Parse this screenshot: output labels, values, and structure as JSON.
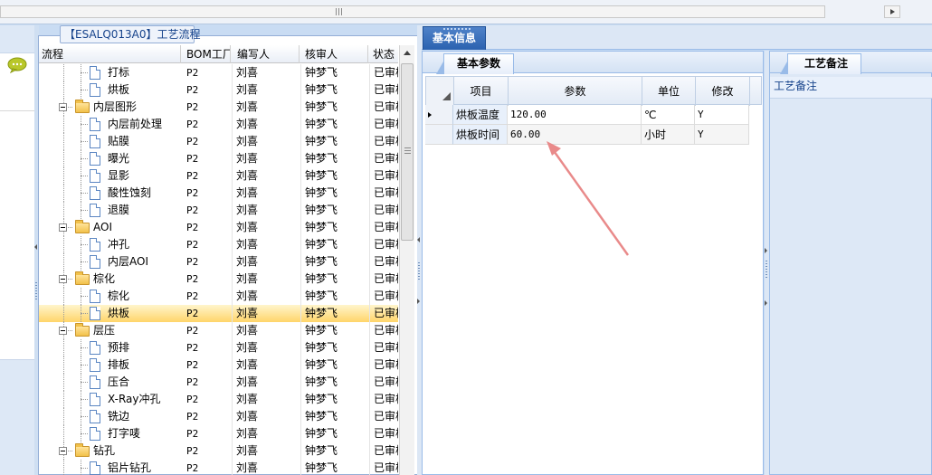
{
  "colors": {
    "accent": "#2b62b0",
    "selection": "#ffd56a",
    "annotation_arrow": "#e98a8a"
  },
  "group": {
    "title": "【ESALQ013A0】工艺流程"
  },
  "tree": {
    "headers": {
      "name": "流程",
      "bom_plant": "BOM工厂",
      "author": "编写人",
      "reviewer": "核审人",
      "status": "状态"
    },
    "rows": [
      {
        "name": "打标",
        "type": "doc",
        "level": 1,
        "bom": "P2",
        "author": "刘喜",
        "reviewer": "钟梦飞",
        "status": "已审核",
        "selected": false
      },
      {
        "name": "烘板",
        "type": "doc",
        "level": 1,
        "bom": "P2",
        "author": "刘喜",
        "reviewer": "钟梦飞",
        "status": "已审核",
        "selected": false
      },
      {
        "name": "内层图形",
        "type": "folder",
        "level": 0,
        "bom": "P2",
        "author": "刘喜",
        "reviewer": "钟梦飞",
        "status": "已审核",
        "selected": false
      },
      {
        "name": "内层前处理",
        "type": "doc",
        "level": 1,
        "bom": "P2",
        "author": "刘喜",
        "reviewer": "钟梦飞",
        "status": "已审核",
        "selected": false
      },
      {
        "name": "贴膜",
        "type": "doc",
        "level": 1,
        "bom": "P2",
        "author": "刘喜",
        "reviewer": "钟梦飞",
        "status": "已审核",
        "selected": false
      },
      {
        "name": "曝光",
        "type": "doc",
        "level": 1,
        "bom": "P2",
        "author": "刘喜",
        "reviewer": "钟梦飞",
        "status": "已审核",
        "selected": false
      },
      {
        "name": "显影",
        "type": "doc",
        "level": 1,
        "bom": "P2",
        "author": "刘喜",
        "reviewer": "钟梦飞",
        "status": "已审核",
        "selected": false
      },
      {
        "name": "酸性蚀刻",
        "type": "doc",
        "level": 1,
        "bom": "P2",
        "author": "刘喜",
        "reviewer": "钟梦飞",
        "status": "已审核",
        "selected": false
      },
      {
        "name": "退膜",
        "type": "doc",
        "level": 1,
        "bom": "P2",
        "author": "刘喜",
        "reviewer": "钟梦飞",
        "status": "已审核",
        "selected": false
      },
      {
        "name": "AOI",
        "type": "folder",
        "level": 0,
        "bom": "P2",
        "author": "刘喜",
        "reviewer": "钟梦飞",
        "status": "已审核",
        "selected": false
      },
      {
        "name": "冲孔",
        "type": "doc",
        "level": 1,
        "bom": "P2",
        "author": "刘喜",
        "reviewer": "钟梦飞",
        "status": "已审核",
        "selected": false
      },
      {
        "name": "内层AOI",
        "type": "doc",
        "level": 1,
        "bom": "P2",
        "author": "刘喜",
        "reviewer": "钟梦飞",
        "status": "已审核",
        "selected": false
      },
      {
        "name": "棕化",
        "type": "folder",
        "level": 0,
        "bom": "P2",
        "author": "刘喜",
        "reviewer": "钟梦飞",
        "status": "已审核",
        "selected": false
      },
      {
        "name": "棕化",
        "type": "doc",
        "level": 1,
        "bom": "P2",
        "author": "刘喜",
        "reviewer": "钟梦飞",
        "status": "已审核",
        "selected": false
      },
      {
        "name": "烘板",
        "type": "doc",
        "level": 1,
        "bom": "P2",
        "author": "刘喜",
        "reviewer": "钟梦飞",
        "status": "已审核",
        "selected": true
      },
      {
        "name": "层压",
        "type": "folder",
        "level": 0,
        "bom": "P2",
        "author": "刘喜",
        "reviewer": "钟梦飞",
        "status": "已审核",
        "selected": false
      },
      {
        "name": "预排",
        "type": "doc",
        "level": 1,
        "bom": "P2",
        "author": "刘喜",
        "reviewer": "钟梦飞",
        "status": "已审核",
        "selected": false
      },
      {
        "name": "排板",
        "type": "doc",
        "level": 1,
        "bom": "P2",
        "author": "刘喜",
        "reviewer": "钟梦飞",
        "status": "已审核",
        "selected": false
      },
      {
        "name": "压合",
        "type": "doc",
        "level": 1,
        "bom": "P2",
        "author": "刘喜",
        "reviewer": "钟梦飞",
        "status": "已审核",
        "selected": false
      },
      {
        "name": "X-Ray冲孔",
        "type": "doc",
        "level": 1,
        "bom": "P2",
        "author": "刘喜",
        "reviewer": "钟梦飞",
        "status": "已审核",
        "selected": false
      },
      {
        "name": "铣边",
        "type": "doc",
        "level": 1,
        "bom": "P2",
        "author": "刘喜",
        "reviewer": "钟梦飞",
        "status": "已审核",
        "selected": false
      },
      {
        "name": "打字唛",
        "type": "doc",
        "level": 1,
        "bom": "P2",
        "author": "刘喜",
        "reviewer": "钟梦飞",
        "status": "已审核",
        "selected": false
      },
      {
        "name": "钻孔",
        "type": "folder",
        "level": 0,
        "bom": "P2",
        "author": "刘喜",
        "reviewer": "钟梦飞",
        "status": "已审核",
        "selected": false
      },
      {
        "name": "铝片钻孔",
        "type": "doc",
        "level": 1,
        "bom": "P2",
        "author": "刘喜",
        "reviewer": "钟梦飞",
        "status": "已审核",
        "selected": false
      }
    ]
  },
  "tabs": {
    "basic_info": "基本信息",
    "basic_params": "基本参数",
    "craft_remarks": "工艺备注"
  },
  "params": {
    "headers": {
      "item": "项目",
      "param": "参数",
      "unit": "单位",
      "modify": "修改"
    },
    "rows": [
      {
        "item": "烘板温度",
        "param": "120.00",
        "unit": "℃",
        "modify": "Y",
        "current": true
      },
      {
        "item": "烘板时间",
        "param": "60.00",
        "unit": "小时",
        "modify": "Y",
        "current": false
      }
    ]
  },
  "remarks": {
    "label": "工艺备注"
  }
}
